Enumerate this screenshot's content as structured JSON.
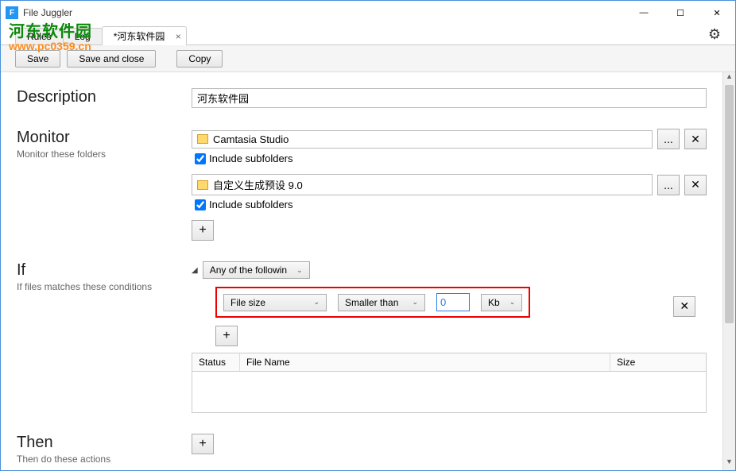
{
  "app": {
    "title": "File Juggler",
    "icon_letter": "F"
  },
  "window_controls": {
    "min": "—",
    "max": "☐",
    "close": "✕"
  },
  "watermark": {
    "line1": "河东软件园",
    "line2": "www.pc0359.cn"
  },
  "tabs": {
    "items": [
      {
        "label": "Rules",
        "active": false
      },
      {
        "label": "Log",
        "active": false
      },
      {
        "label": "*河东软件园",
        "active": true
      }
    ],
    "close_glyph": "×"
  },
  "toolbar": {
    "save": "Save",
    "save_close": "Save and close",
    "copy": "Copy"
  },
  "gear_icon": "⚙",
  "sections": {
    "description": {
      "title": "Description",
      "value": "河东软件园"
    },
    "monitor": {
      "title": "Monitor",
      "subtitle": "Monitor these folders",
      "folders": [
        {
          "name": "Camtasia Studio",
          "include_sub": true
        },
        {
          "name": "自定义生成预设 9.0",
          "include_sub": true
        }
      ],
      "include_label": "Include subfolders",
      "browse": "...",
      "delete": "✕",
      "add": "+"
    },
    "if": {
      "title": "If",
      "subtitle": "If files matches these conditions",
      "collapse": "◢",
      "match_mode": "Any of the followin",
      "condition": {
        "field": "File size",
        "operator": "Smaller than",
        "value": "0",
        "unit": "Kb"
      },
      "add": "+",
      "delete": "✕",
      "table": {
        "col_status": "Status",
        "col_filename": "File Name",
        "col_size": "Size"
      }
    },
    "then": {
      "title": "Then",
      "subtitle": "Then do these actions",
      "add": "+"
    }
  },
  "chevron": "⌄"
}
